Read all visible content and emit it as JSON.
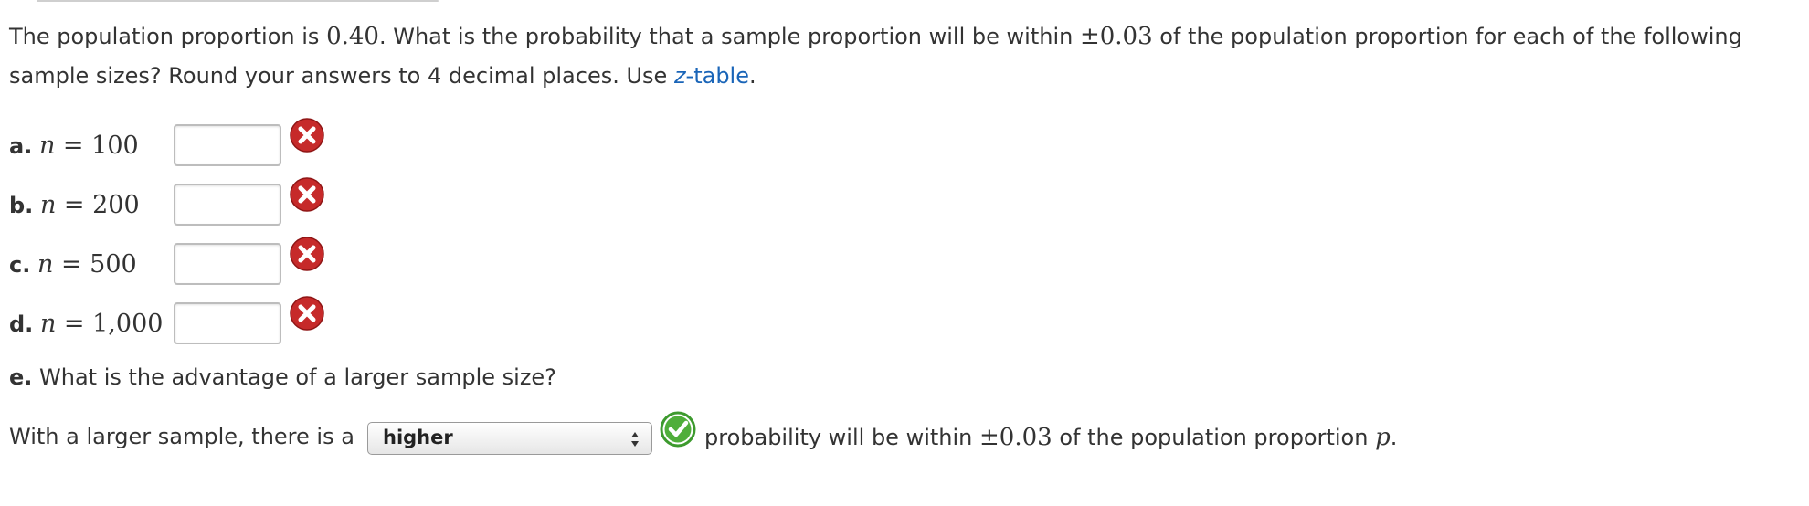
{
  "question": {
    "text_1": "The population proportion is ",
    "population_proportion": "0.40",
    "text_2": ". What is the probability that a sample proportion will be within ",
    "margin": "±0.03",
    "text_3": " of the population proportion for each of the following sample sizes? Round your answers to 4 decimal places. Use ",
    "link_italic": "z",
    "link_rest": "-table",
    "text_4": "."
  },
  "parts": [
    {
      "letter": "a.",
      "var": "n",
      "eq": " = ",
      "value": "100",
      "answer": "",
      "status": "incorrect"
    },
    {
      "letter": "b.",
      "var": "n",
      "eq": " = ",
      "value": "200",
      "answer": "",
      "status": "incorrect"
    },
    {
      "letter": "c.",
      "var": "n",
      "eq": " = ",
      "value": "500",
      "answer": "",
      "status": "incorrect"
    },
    {
      "letter": "d.",
      "var": "n",
      "eq": " = ",
      "value": "1,000",
      "answer": "",
      "status": "incorrect"
    }
  ],
  "part_e": {
    "letter": "e.",
    "question": " What is the advantage of a larger sample size?"
  },
  "final_sentence": {
    "prefix": "With a larger sample, there is a",
    "select_value": "higher",
    "status": "correct",
    "suffix_1": "probability will be within ",
    "margin": "±0.03",
    "suffix_2": " of the population proportion ",
    "symbol": "p",
    "suffix_3": "."
  },
  "colors": {
    "link": "#1a65b8",
    "incorrect": "#c62a2a",
    "correct": "#3d9a2e"
  },
  "icons": {
    "incorrect": "x-circle-icon",
    "correct": "check-circle-icon"
  }
}
